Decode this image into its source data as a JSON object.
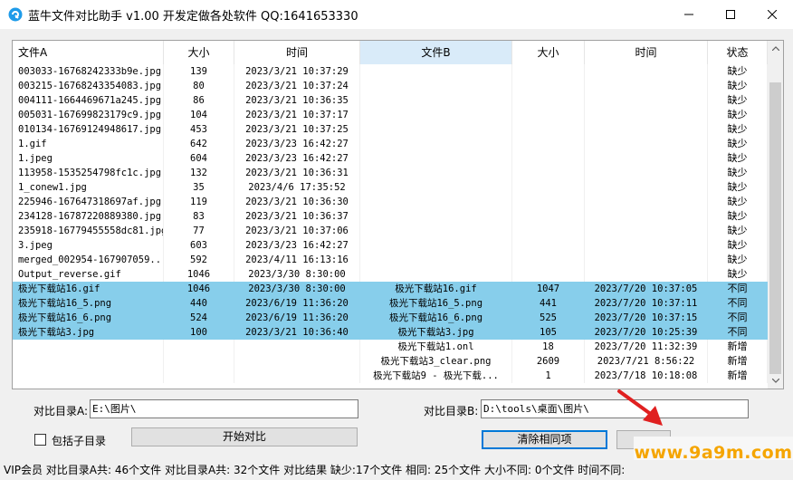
{
  "window": {
    "title": "蓝牛文件对比助手 v1.00 开发定做各处软件 QQ:1641653330"
  },
  "grid": {
    "columns": [
      "文件A",
      "大小",
      "时间",
      "文件B",
      "大小",
      "时间",
      "状态"
    ],
    "rows": [
      {
        "a": "003033-16768242333b9e.jpg",
        "sa": "139",
        "ta": "2023/3/21 10:37:29",
        "b": "",
        "sb": "",
        "tb": "",
        "st": "缺少",
        "sel": false
      },
      {
        "a": "003215-1676824335408З.jpg",
        "sa": "80",
        "ta": "2023/3/21 10:37:24",
        "b": "",
        "sb": "",
        "tb": "",
        "st": "缺少",
        "sel": false
      },
      {
        "a": "004111-1664469671a245.jpg",
        "sa": "86",
        "ta": "2023/3/21 10:36:35",
        "b": "",
        "sb": "",
        "tb": "",
        "st": "缺少",
        "sel": false
      },
      {
        "a": "005031-167699823179c9.jpg",
        "sa": "104",
        "ta": "2023/3/21 10:37:17",
        "b": "",
        "sb": "",
        "tb": "",
        "st": "缺少",
        "sel": false
      },
      {
        "a": "010134-16769124948617.jpg",
        "sa": "453",
        "ta": "2023/3/21 10:37:25",
        "b": "",
        "sb": "",
        "tb": "",
        "st": "缺少",
        "sel": false
      },
      {
        "a": "1.gif",
        "sa": "642",
        "ta": "2023/3/23 16:42:27",
        "b": "",
        "sb": "",
        "tb": "",
        "st": "缺少",
        "sel": false
      },
      {
        "a": "1.jpeg",
        "sa": "604",
        "ta": "2023/3/23 16:42:27",
        "b": "",
        "sb": "",
        "tb": "",
        "st": "缺少",
        "sel": false
      },
      {
        "a": "113958-1535254798fc1c.jpg",
        "sa": "132",
        "ta": "2023/3/21 10:36:31",
        "b": "",
        "sb": "",
        "tb": "",
        "st": "缺少",
        "sel": false
      },
      {
        "a": "1_conew1.jpg",
        "sa": "35",
        "ta": "2023/4/6 17:35:52",
        "b": "",
        "sb": "",
        "tb": "",
        "st": "缺少",
        "sel": false
      },
      {
        "a": "225946-167647318697af.jpg",
        "sa": "119",
        "ta": "2023/3/21 10:36:30",
        "b": "",
        "sb": "",
        "tb": "",
        "st": "缺少",
        "sel": false
      },
      {
        "a": "234128-16787220889380.jpg",
        "sa": "83",
        "ta": "2023/3/21 10:36:37",
        "b": "",
        "sb": "",
        "tb": "",
        "st": "缺少",
        "sel": false
      },
      {
        "a": "235918-16779455558dc81.jpg",
        "sa": "77",
        "ta": "2023/3/21 10:37:06",
        "b": "",
        "sb": "",
        "tb": "",
        "st": "缺少",
        "sel": false
      },
      {
        "a": "3.jpeg",
        "sa": "603",
        "ta": "2023/3/23 16:42:27",
        "b": "",
        "sb": "",
        "tb": "",
        "st": "缺少",
        "sel": false
      },
      {
        "a": "merged_002954-167907059...",
        "sa": "592",
        "ta": "2023/4/11 16:13:16",
        "b": "",
        "sb": "",
        "tb": "",
        "st": "缺少",
        "sel": false
      },
      {
        "a": "Output_reverse.gif",
        "sa": "1046",
        "ta": "2023/3/30 8:30:00",
        "b": "",
        "sb": "",
        "tb": "",
        "st": "缺少",
        "sel": false
      },
      {
        "a": "极光下载站16.gif",
        "sa": "1046",
        "ta": "2023/3/30 8:30:00",
        "b": "极光下载站16.gif",
        "sb": "1047",
        "tb": "2023/7/20 10:37:05",
        "st": "不同",
        "sel": true
      },
      {
        "a": "极光下载站16_5.png",
        "sa": "440",
        "ta": "2023/6/19 11:36:20",
        "b": "极光下载站16_5.png",
        "sb": "441",
        "tb": "2023/7/20 10:37:11",
        "st": "不同",
        "sel": true
      },
      {
        "a": "极光下载站16_6.png",
        "sa": "524",
        "ta": "2023/6/19 11:36:20",
        "b": "极光下载站16_6.png",
        "sb": "525",
        "tb": "2023/7/20 10:37:15",
        "st": "不同",
        "sel": true
      },
      {
        "a": "极光下载站3.jpg",
        "sa": "100",
        "ta": "2023/3/21 10:36:40",
        "b": "极光下载站3.jpg",
        "sb": "105",
        "tb": "2023/7/20 10:25:39",
        "st": "不同",
        "sel": true
      },
      {
        "a": "",
        "sa": "",
        "ta": "",
        "b": "极光下载站1.onl",
        "sb": "18",
        "tb": "2023/7/20 11:32:39",
        "st": "新增",
        "sel": false
      },
      {
        "a": "",
        "sa": "",
        "ta": "",
        "b": "极光下载站3_clear.png",
        "sb": "2609",
        "tb": "2023/7/21 8:56:22",
        "st": "新增",
        "sel": false
      },
      {
        "a": "",
        "sa": "",
        "ta": "",
        "b": "极光下载站9 - 极光下载...",
        "sb": "1",
        "tb": "2023/7/18 10:18:08",
        "st": "新增",
        "sel": false
      }
    ]
  },
  "form": {
    "dir_a_label": "对比目录A:",
    "dir_a_value": "E:\\图片\\",
    "dir_b_label": "对比目录B:",
    "dir_b_value": "D:\\tools\\桌面\\图片\\",
    "include_subdirs_label": "包括子目录",
    "include_subdirs_checked": false,
    "start_button": "开始对比",
    "clear_same_button": "清除相同项"
  },
  "status": {
    "text": "VIP会员  对比目录A共: 46个文件  对比目录A共: 32个文件  对比结果 缺少:17个文件 相同: 25个文件 大小不同: 0个文件 时间不同:"
  },
  "watermark": {
    "text": "www.9a9m.com"
  },
  "colors": {
    "selected_row": "#87ceeb",
    "sorted_header": "#d9ebf9",
    "annotation_arrow": "#e02020",
    "watermark_text": "#f5a500"
  }
}
